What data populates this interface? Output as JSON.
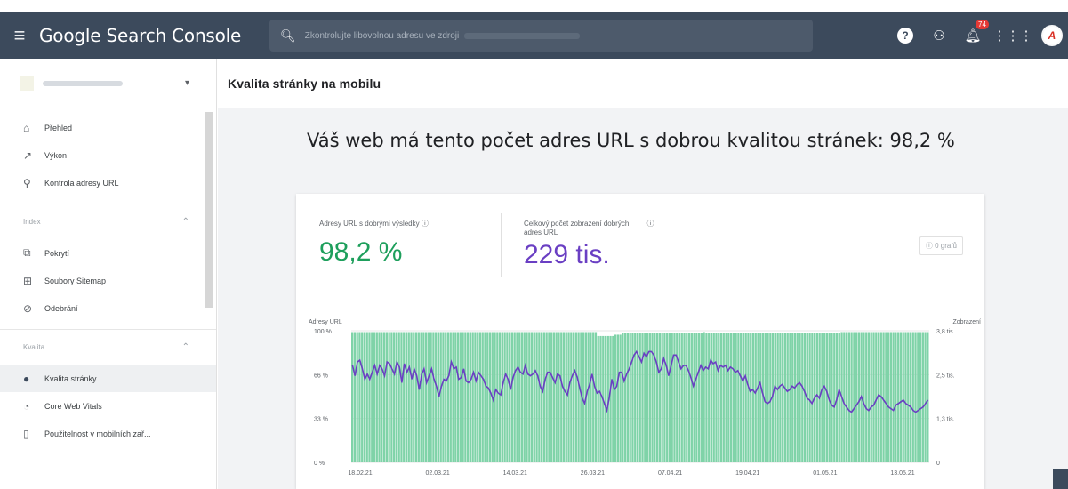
{
  "app": {
    "title": "Google Search Console",
    "search_placeholder": "Zkontrolujte libovolnou adresu ve zdroji",
    "notification_count": "74",
    "avatar_initial": "A"
  },
  "property": {
    "name": ""
  },
  "page": {
    "title": "Kvalita stránky na mobilu"
  },
  "sidebar": {
    "top_items": [
      {
        "label": "Přehled",
        "icon": "home-icon"
      },
      {
        "label": "Výkon",
        "icon": "trend-icon"
      },
      {
        "label": "Kontrola adresy URL",
        "icon": "search-icon"
      }
    ],
    "sections": [
      {
        "title": "Index",
        "items": [
          {
            "label": "Pokrytí",
            "icon": "coverage-icon"
          },
          {
            "label": "Soubory Sitemap",
            "icon": "sitemap-icon"
          },
          {
            "label": "Odebrání",
            "icon": "removal-icon"
          }
        ]
      },
      {
        "title": "Kvalita",
        "items": [
          {
            "label": "Kvalita stránky",
            "icon": "page-quality-icon"
          },
          {
            "label": "Core Web Vitals",
            "icon": "gauge-icon"
          },
          {
            "label": "Použitelnost v mobilních zař...",
            "icon": "phone-icon"
          }
        ]
      }
    ]
  },
  "main": {
    "headline": "Váš web má tento počet adres URL s dobrou kvalitou stránek: 98,2 %",
    "metrics": {
      "good_urls_label": "Adresy URL s dobrými výsledky",
      "good_urls_value": "98,2 %",
      "views_label_line1": "Celkový počet zobrazení dobrých",
      "views_label_line2": "adres URL",
      "views_value": "229 tis."
    },
    "graph_button": "0 grafů"
  },
  "colors": {
    "good": "#1e9f5c",
    "bars": "#7fd3a8",
    "views": "#6a3fc3",
    "appbar": "#3c4a5c"
  },
  "chart_data": {
    "type": "bar",
    "left_axis_title": "Adresy URL",
    "right_axis_title": "Zobrazení",
    "left_ticks": [
      "100 %",
      "66 %",
      "33 %",
      "0 %"
    ],
    "right_ticks": [
      "3,8 tis.",
      "2,5 tis.",
      "1,3 tis.",
      "0"
    ],
    "x_ticks": [
      "18.02.21",
      "02.03.21",
      "14.03.21",
      "26.03.21",
      "07.04.21",
      "19.04.21",
      "01.05.21",
      "13.05.21"
    ],
    "left_ylim": [
      0,
      100
    ],
    "right_ylim": [
      0,
      3800
    ],
    "series": [
      {
        "name": "Adresy URL s dobrými výsledky",
        "kind": "bar",
        "values": [
          99,
          99,
          99,
          99,
          99,
          99,
          99,
          99,
          99,
          99,
          99,
          99,
          99,
          99,
          99,
          99,
          99,
          99,
          99,
          99,
          99,
          99,
          99,
          99,
          99,
          99,
          99,
          99,
          99,
          99,
          99,
          99,
          99,
          99,
          99,
          99,
          99,
          99,
          99,
          99,
          99,
          99,
          99,
          99,
          99,
          99,
          99,
          99,
          99,
          99,
          99,
          99,
          99,
          99,
          99,
          99,
          99,
          99,
          99,
          99,
          99,
          99,
          99,
          99,
          99,
          99,
          99,
          99,
          99,
          99,
          99,
          99,
          99,
          99,
          99,
          99,
          99,
          99,
          99,
          99,
          99,
          99,
          99,
          99,
          99,
          99,
          99,
          99,
          99,
          99,
          99,
          99,
          99,
          99,
          99,
          99,
          99,
          99,
          99,
          99,
          96,
          96,
          96,
          96,
          96,
          96,
          96,
          97,
          97,
          97,
          98,
          98,
          98,
          98,
          98,
          98,
          98,
          98,
          98,
          98,
          98,
          98,
          98,
          98,
          98,
          98,
          98,
          98,
          98,
          98,
          98,
          98,
          98,
          98,
          98,
          98,
          98,
          98,
          98,
          98,
          98,
          98,
          98,
          99,
          98,
          98,
          98,
          98,
          98,
          98,
          98,
          98,
          98,
          98,
          98,
          98,
          98,
          98,
          98,
          98,
          98,
          98,
          98,
          98,
          98,
          98,
          98,
          98,
          98,
          98,
          98,
          98,
          98,
          98,
          98,
          98,
          98,
          98,
          98,
          98,
          98,
          98,
          98,
          98,
          98,
          98,
          98,
          98,
          98,
          98,
          98,
          98,
          98,
          98,
          98,
          98,
          98,
          98,
          98,
          99,
          99,
          99,
          99,
          99,
          99,
          99,
          99,
          99,
          99,
          99,
          99,
          99,
          99,
          99,
          99,
          99,
          99,
          99,
          99,
          99,
          99,
          99,
          99,
          99,
          99,
          99,
          99,
          99,
          99,
          99,
          99,
          99,
          99,
          99,
          99
        ]
      },
      {
        "name": "Zobrazení",
        "kind": "line",
        "values": [
          2800,
          2500,
          2900,
          2950,
          2700,
          2400,
          2550,
          2400,
          2600,
          2800,
          2550,
          2800,
          2700,
          2500,
          2900,
          2850,
          2700,
          2550,
          2900,
          2750,
          2300,
          2850,
          2600,
          2750,
          2400,
          2700,
          2500,
          2100,
          2550,
          2700,
          2300,
          2500,
          2700,
          2400,
          2200,
          1900,
          2200,
          2400,
          2350,
          2500,
          2900,
          2700,
          2750,
          2400,
          2450,
          2700,
          2350,
          2300,
          2400,
          2600,
          2350,
          2600,
          2500,
          2400,
          2200,
          2150,
          2000,
          1800,
          2100,
          2000,
          1950,
          2300,
          2550,
          2400,
          2100,
          2450,
          2650,
          2750,
          2600,
          2550,
          2800,
          2550,
          2500,
          2550,
          2650,
          2500,
          2200,
          2050,
          2400,
          2600,
          2600,
          2450,
          2300,
          2550,
          2500,
          2200,
          2050,
          1950,
          2300,
          2500,
          2650,
          2450,
          2150,
          1850,
          1700,
          2050,
          2250,
          2550,
          2200,
          2000,
          2050,
          1900,
          1700,
          1500,
          1900,
          2400,
          2100,
          2200,
          2600,
          2600,
          2350,
          2550,
          2700,
          2900,
          3100,
          3200,
          3050,
          2900,
          3150,
          3050,
          3200,
          3200,
          3100,
          2900,
          2600,
          2700,
          3000,
          2800,
          2500,
          2800,
          3100,
          3100,
          2900,
          2700,
          2800,
          2800,
          2650,
          2450,
          2200,
          2400,
          2600,
          2800,
          2650,
          2750,
          2700,
          2950,
          2850,
          2900,
          2650,
          2800,
          2750,
          2800,
          2650,
          2750,
          2700,
          2600,
          2650,
          2500,
          2350,
          2500,
          2250,
          2050,
          2100,
          2000,
          2150,
          2300,
          2000,
          1750,
          1700,
          1750,
          1900,
          2200,
          2100,
          2200,
          2250,
          2150,
          2050,
          2100,
          2200,
          2150,
          2250,
          2300,
          2200,
          2050,
          1850,
          1800,
          1700,
          1850,
          1950,
          1850,
          2100,
          2200,
          2050,
          1800,
          1650,
          1600,
          1800,
          2100,
          1900,
          1700,
          1600,
          1500,
          1450,
          1550,
          1650,
          1750,
          1900,
          1700,
          1550,
          1500,
          1600,
          1650,
          1800,
          1950,
          1900,
          1800,
          1700,
          1600,
          1550,
          1500,
          1650,
          1700,
          1750,
          1800,
          1700,
          1650,
          1600,
          1500,
          1450,
          1500,
          1550,
          1600,
          1700,
          1800
        ]
      }
    ]
  }
}
